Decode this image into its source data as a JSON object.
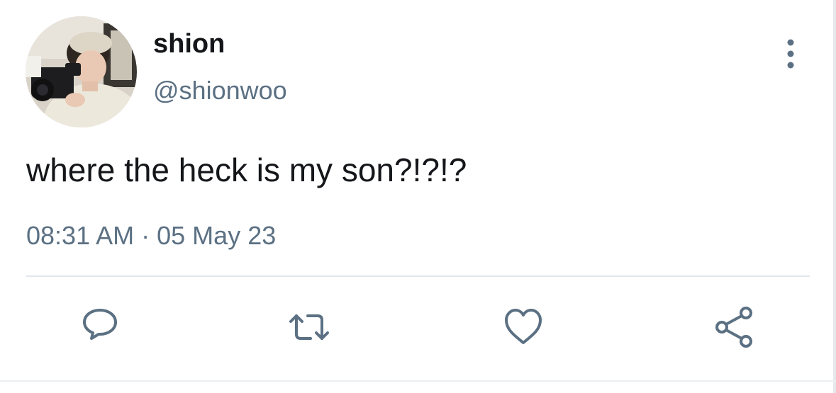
{
  "author": {
    "display_name": "shion",
    "handle": "@shionwoo",
    "avatar": "profile-photo"
  },
  "tweet": {
    "text": "where the heck is my son?!?!?",
    "time": "08:31 AM",
    "separator": "·",
    "date": "05 May 23"
  },
  "actions": {
    "reply_icon": "reply-icon",
    "retweet_icon": "retweet-icon",
    "like_icon": "heart-icon",
    "share_icon": "share-icon",
    "more_icon": "more-vertical-icon"
  },
  "colors": {
    "text_primary": "#141619",
    "text_secondary": "#5b7083",
    "icon": "#5b7083",
    "divider": "#e1e6ea"
  }
}
